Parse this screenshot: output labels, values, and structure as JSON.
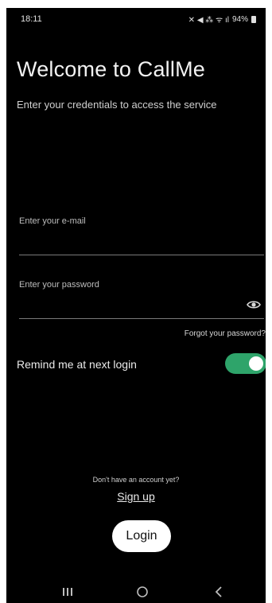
{
  "status_bar": {
    "time": "18:11",
    "indicators": "✕ ◀ ⁂ ᯤ ıl",
    "battery": "94%"
  },
  "header": {
    "title": "Welcome to CallMe",
    "subtitle": "Enter your credentials to access the service"
  },
  "form": {
    "email_label": "Enter your e-mail",
    "email_value": "",
    "password_label": "Enter your password",
    "password_value": "",
    "forgot_label": "Forgot your password?",
    "remind_label": "Remind me at next login",
    "remind_enabled": true
  },
  "footer": {
    "no_account": "Don't have an account yet?",
    "signup_label": "Sign up",
    "login_label": "Login"
  },
  "colors": {
    "background": "#000000",
    "toggle_on": "#2ea46a",
    "button": "#ffffff"
  },
  "icons": [
    "eye-icon",
    "recent-apps-icon",
    "home-icon",
    "back-icon",
    "battery-icon"
  ]
}
